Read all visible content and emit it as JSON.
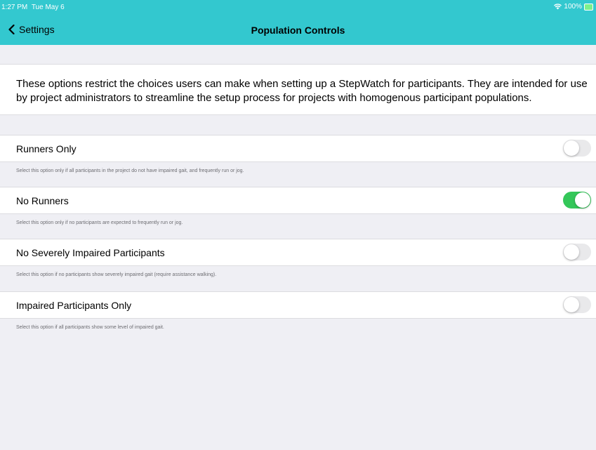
{
  "status_bar": {
    "time": "1:27 PM",
    "date": "Tue May 6",
    "battery": "100%",
    "wifi_icon": "wifi-icon",
    "battery_icon": "battery-charging-icon"
  },
  "nav": {
    "back_label": "Settings",
    "back_icon": "chevron-left-icon",
    "title": "Population Controls"
  },
  "description": "These options restrict the choices users can make when setting up a StepWatch for participants. They are intended for use by project administrators to streamline the setup process for projects with homogenous participant populations.",
  "options": [
    {
      "label": "Runners Only",
      "enabled": false,
      "footer": "Select this option only if all participants in the project do not have impaired gait, and frequently run or jog."
    },
    {
      "label": "No Runners",
      "enabled": true,
      "footer": "Select this option only if no participants are expected to frequently run or jog."
    },
    {
      "label": "No Severely Impaired Participants",
      "enabled": false,
      "footer": "Select this option if no participants show severely impaired gait (require assistance walking)."
    },
    {
      "label": "Impaired Participants Only",
      "enabled": false,
      "footer": "Select this option if all participants show some level of impaired gait."
    }
  ],
  "colors": {
    "nav_background": "#33c8cf",
    "toggle_on": "#34c759",
    "toggle_off": "#e9e9eb"
  }
}
